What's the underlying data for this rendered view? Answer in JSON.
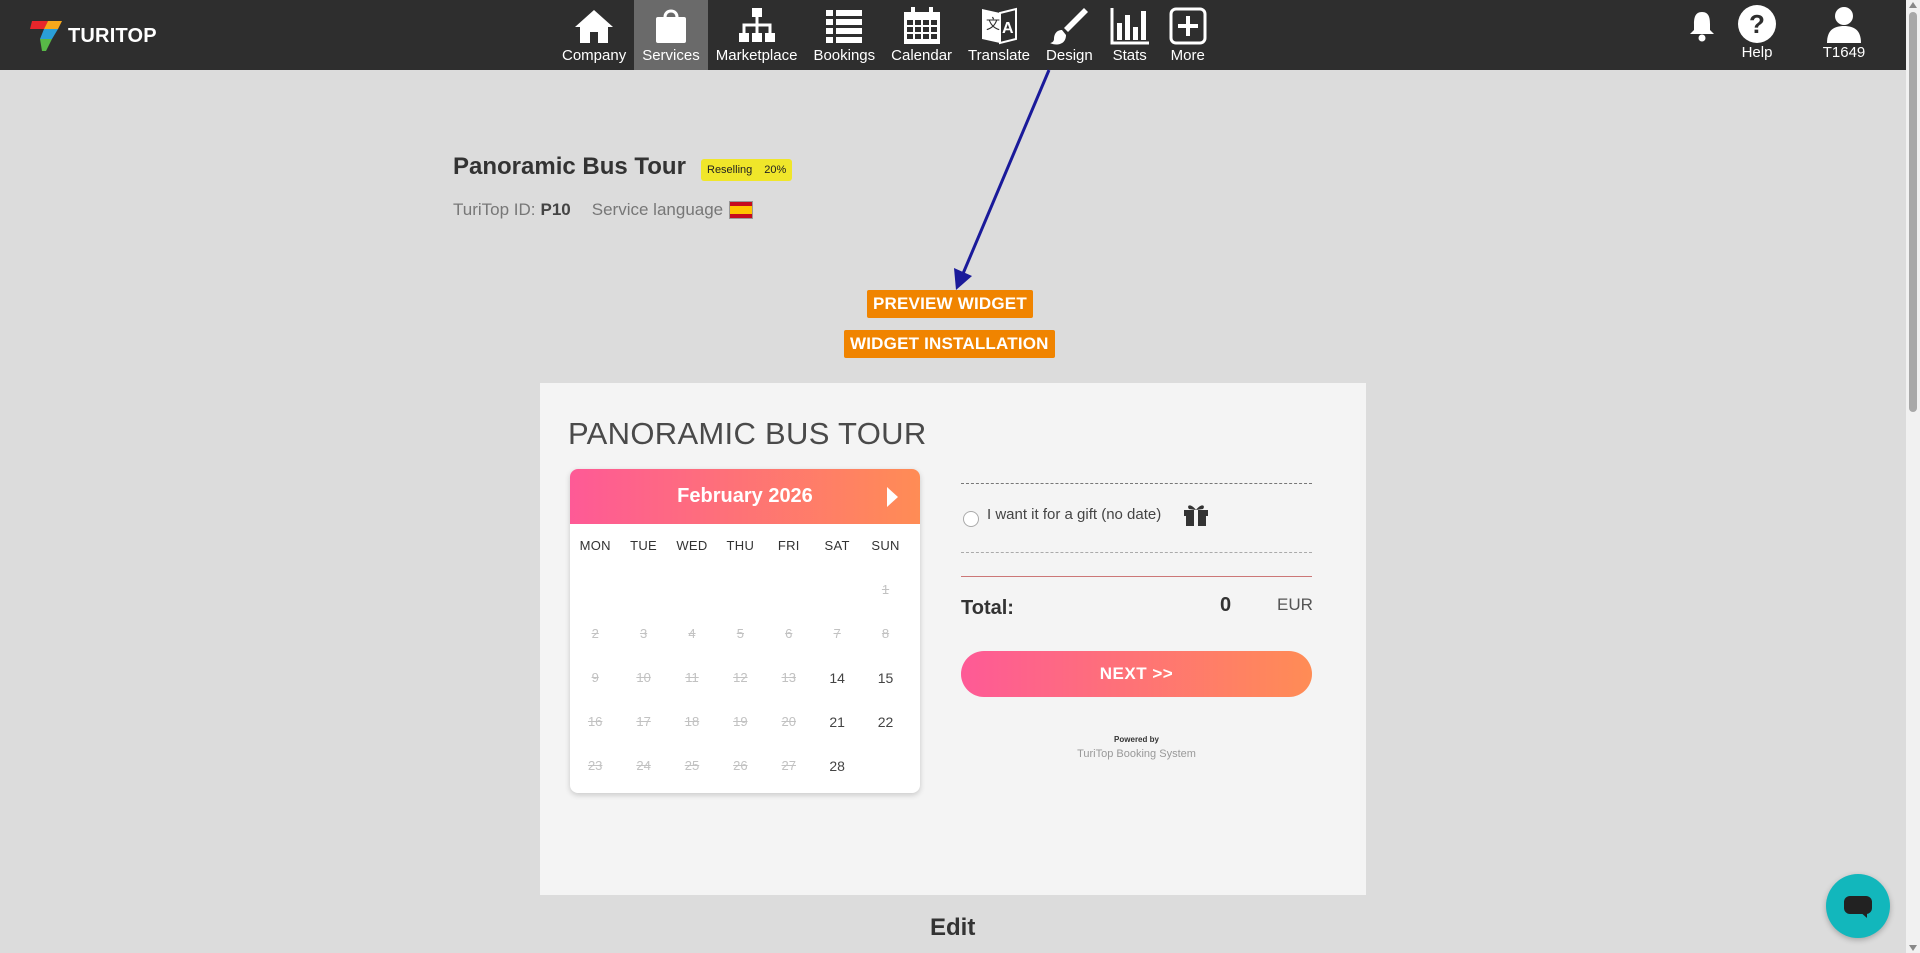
{
  "header": {
    "logo_text": "TURITOP",
    "nav": [
      {
        "label": "Company",
        "icon": "home-icon"
      },
      {
        "label": "Services",
        "icon": "shopping-bag-icon",
        "active": true
      },
      {
        "label": "Marketplace",
        "icon": "sitemap-icon"
      },
      {
        "label": "Bookings",
        "icon": "list-icon"
      },
      {
        "label": "Calendar",
        "icon": "calendar-icon"
      },
      {
        "label": "Translate",
        "icon": "translate-icon"
      },
      {
        "label": "Design",
        "icon": "paintbrush-icon"
      },
      {
        "label": "Stats",
        "icon": "bar-chart-icon"
      },
      {
        "label": "More",
        "icon": "plus-square-icon"
      }
    ],
    "help_label": "Help",
    "user_label": "T1649"
  },
  "service": {
    "title": "Panoramic Bus Tour",
    "badge_label": "Reselling",
    "badge_value": "20%",
    "id_label": "TuriTop ID:",
    "id_value": "P10",
    "language_label": "Service language"
  },
  "actions": {
    "preview": "PREVIEW WIDGET",
    "install": "WIDGET INSTALLATION"
  },
  "widget": {
    "title": "PANORAMIC BUS TOUR",
    "month": "February 2026",
    "weekdays": [
      "MON",
      "TUE",
      "WED",
      "THU",
      "FRI",
      "SAT",
      "SUN"
    ],
    "weeks": [
      [
        "",
        "",
        "",
        "",
        "",
        "",
        "1"
      ],
      [
        "2",
        "3",
        "4",
        "5",
        "6",
        "7",
        "8"
      ],
      [
        "9",
        "10",
        "11",
        "12",
        "13",
        "14",
        "15"
      ],
      [
        "16",
        "17",
        "18",
        "19",
        "20",
        "21",
        "22"
      ],
      [
        "23",
        "24",
        "25",
        "26",
        "27",
        "28",
        ""
      ]
    ],
    "available_days": [
      "14",
      "15",
      "21",
      "22",
      "28"
    ],
    "gift_label": "I want it for a gift  (no date)",
    "total_label": "Total:",
    "total_value": "0",
    "currency": "EUR",
    "next_label": "NEXT >>",
    "powered_by": "Powered by",
    "powered_system": "TuriTop Booking System"
  },
  "edit_heading": "Edit",
  "colors": {
    "topbar": "#2e2e2e",
    "accent_orange": "#f08400",
    "gradient_start": "#fe5a96",
    "gradient_end": "#ff8c55",
    "badge": "#f0e62a",
    "chat": "#12b7bc"
  }
}
